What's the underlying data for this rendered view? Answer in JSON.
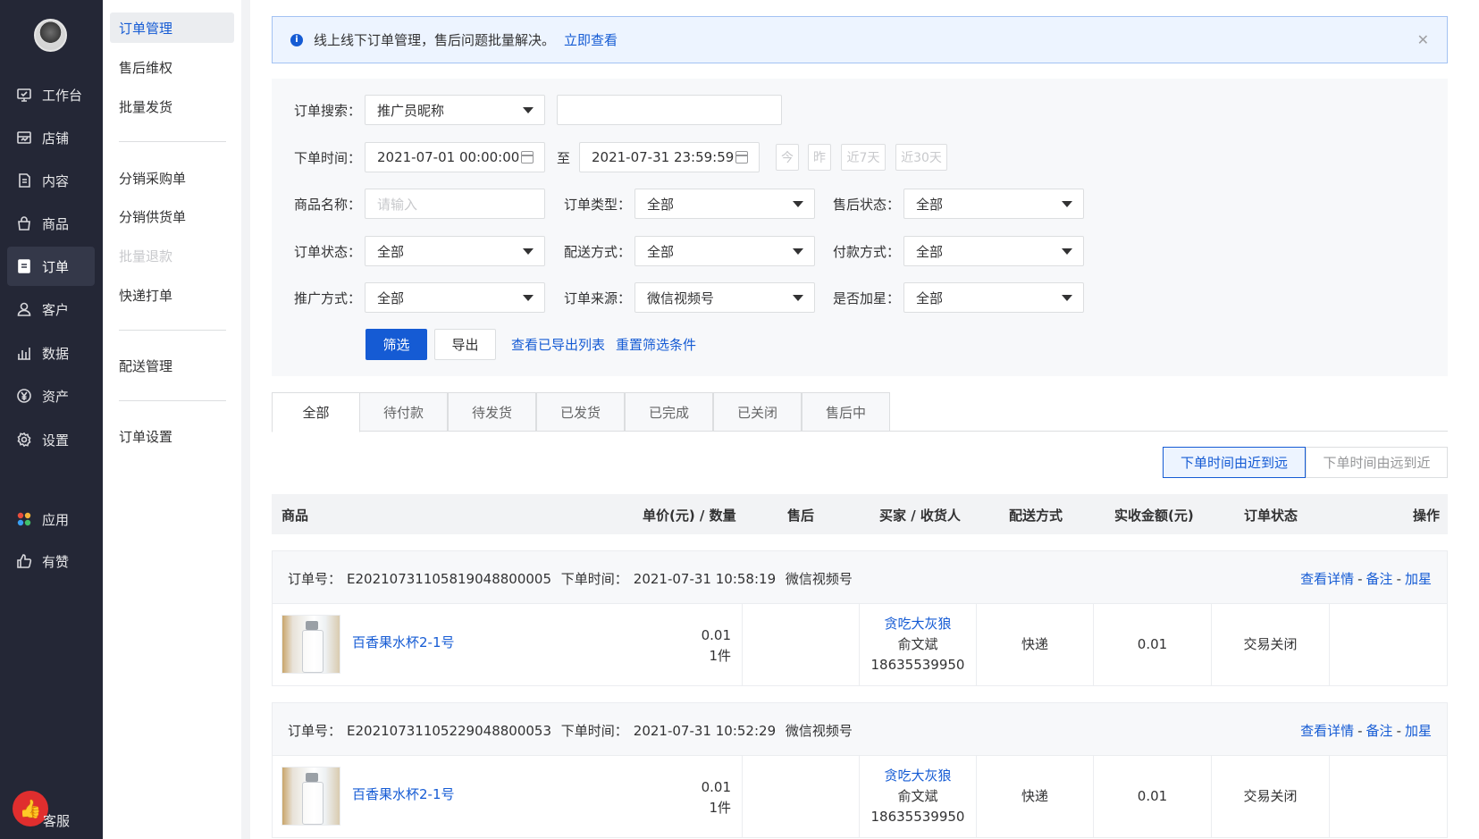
{
  "nav": {
    "items": [
      {
        "label": "工作台",
        "icon": "workbench-icon"
      },
      {
        "label": "店铺",
        "icon": "shop-icon"
      },
      {
        "label": "内容",
        "icon": "content-icon"
      },
      {
        "label": "商品",
        "icon": "goods-icon"
      },
      {
        "label": "订单",
        "icon": "order-icon",
        "active": true
      },
      {
        "label": "客户",
        "icon": "customer-icon"
      },
      {
        "label": "数据",
        "icon": "data-icon"
      },
      {
        "label": "资产",
        "icon": "asset-icon"
      },
      {
        "label": "设置",
        "icon": "settings-icon"
      },
      {
        "label": "应用",
        "icon": "apps-icon"
      },
      {
        "label": "有赞",
        "icon": "thumbs-up-icon"
      }
    ],
    "kefu_label": "客服"
  },
  "submenu": {
    "items": [
      "订单管理",
      "售后维权",
      "批量发货",
      "分销采购单",
      "分销供货单",
      "批量退款",
      "快递打单",
      "配送管理",
      "订单设置"
    ]
  },
  "notice": {
    "text": "线上线下订单管理，售后问题批量解决。",
    "link": "立即查看"
  },
  "filter": {
    "search_label": "订单搜索：",
    "search_type": "推广员昵称",
    "time_label": "下单时间：",
    "start_time": "2021-07-01 00:00:00",
    "to": "至",
    "end_time": "2021-07-31 23:59:59",
    "quick": [
      "今",
      "昨",
      "近7天",
      "近30天"
    ],
    "goods_label": "商品名称：",
    "goods_placeholder": "请输入",
    "order_type_label": "订单类型：",
    "order_type": "全部",
    "aftersale_label": "售后状态：",
    "aftersale": "全部",
    "order_status_label": "订单状态：",
    "order_status": "全部",
    "delivery_label": "配送方式：",
    "delivery": "全部",
    "pay_label": "付款方式：",
    "pay": "全部",
    "promo_label": "推广方式：",
    "promo": "全部",
    "source_label": "订单来源：",
    "source": "微信视频号",
    "star_label": "是否加星：",
    "star": "全部",
    "filter_btn": "筛选",
    "export_btn": "导出",
    "view_exported": "查看已导出列表",
    "reset": "重置筛选条件"
  },
  "tabs": [
    "全部",
    "待付款",
    "待发货",
    "已发货",
    "已完成",
    "已关闭",
    "售后中"
  ],
  "sort": {
    "desc": "下单时间由近到远",
    "asc": "下单时间由远到近"
  },
  "table_headers": {
    "goods": "商品",
    "price_qty": "单价(元) / 数量",
    "aftersale": "售后",
    "buyer": "买家 / 收货人",
    "delivery": "配送方式",
    "amount": "实收金额(元)",
    "status": "订单状态",
    "ops": "操作"
  },
  "orders": [
    {
      "order_no_label": "订单号：",
      "order_no": "E20210731105819048800005",
      "time_label": "下单时间：",
      "time": "2021-07-31 10:58:19",
      "source": "微信视频号",
      "op_detail": "查看详情",
      "op_note": "备注",
      "op_star": "加星",
      "sep": "-",
      "product": "百香果水杯2-1号",
      "price": "0.01",
      "qty": "1件",
      "buyer": "贪吃大灰狼",
      "receiver": "俞文斌",
      "phone": "18635539950",
      "delivery": "快递",
      "amount": "0.01",
      "status": "交易关闭"
    },
    {
      "order_no_label": "订单号：",
      "order_no": "E20210731105229048800053",
      "time_label": "下单时间：",
      "time": "2021-07-31 10:52:29",
      "source": "微信视频号",
      "op_detail": "查看详情",
      "op_note": "备注",
      "op_star": "加星",
      "sep": "-",
      "product": "百香果水杯2-1号",
      "price": "0.01",
      "qty": "1件",
      "buyer": "贪吃大灰狼",
      "receiver": "俞文斌",
      "phone": "18635539950",
      "delivery": "快递",
      "amount": "0.01",
      "status": "交易关闭"
    }
  ],
  "colors": {
    "nav_bg": "#242736",
    "accent": "#155bd4",
    "kefu": "#e02e2e"
  }
}
